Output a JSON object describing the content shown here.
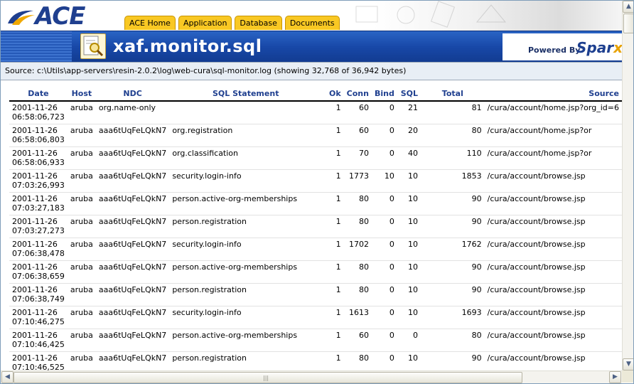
{
  "header": {
    "logo_text": "ACE",
    "tabs": [
      "ACE Home",
      "Application",
      "Database",
      "Documents"
    ],
    "page_title": "xaf.monitor.sql",
    "powered_by": "Powered By",
    "brand": "Spar",
    "brand_x": "x"
  },
  "source_line": "Source: c:\\Utils\\app-servers\\resin-2.0.2\\log\\web-cura\\sql-monitor.log (showing 32,768 of 36,942 bytes)",
  "table": {
    "columns": [
      "Date",
      "Host",
      "NDC",
      "SQL Statement",
      "Ok",
      "Conn",
      "Bind",
      "SQL",
      "Total",
      "Source"
    ],
    "rows": [
      {
        "date": "2001-11-26 06:58:06,723",
        "host": "aruba",
        "ndc": "org.name-only",
        "sql": "",
        "ok": "1",
        "conn": "60",
        "bind": "0",
        "sqlt": "21",
        "total": "81",
        "source": "/cura/account/home.jsp?org_id=6"
      },
      {
        "date": "2001-11-26 06:58:06,803",
        "host": "aruba",
        "ndc": "aaa6tUqFeLQkN7",
        "sql": "org.registration",
        "ok": "1",
        "conn": "60",
        "bind": "0",
        "sqlt": "20",
        "total": "80",
        "source": "/cura/account/home.jsp?or"
      },
      {
        "date": "2001-11-26 06:58:06,933",
        "host": "aruba",
        "ndc": "aaa6tUqFeLQkN7",
        "sql": "org.classification",
        "ok": "1",
        "conn": "70",
        "bind": "0",
        "sqlt": "40",
        "total": "110",
        "source": "/cura/account/home.jsp?or"
      },
      {
        "date": "2001-11-26 07:03:26,993",
        "host": "aruba",
        "ndc": "aaa6tUqFeLQkN7",
        "sql": "security.login-info",
        "ok": "1",
        "conn": "1773",
        "bind": "10",
        "sqlt": "10",
        "total": "1853",
        "source": "/cura/account/browse.jsp"
      },
      {
        "date": "2001-11-26 07:03:27,183",
        "host": "aruba",
        "ndc": "aaa6tUqFeLQkN7",
        "sql": "person.active-org-memberships",
        "ok": "1",
        "conn": "80",
        "bind": "0",
        "sqlt": "10",
        "total": "90",
        "source": "/cura/account/browse.jsp"
      },
      {
        "date": "2001-11-26 07:03:27,273",
        "host": "aruba",
        "ndc": "aaa6tUqFeLQkN7",
        "sql": "person.registration",
        "ok": "1",
        "conn": "80",
        "bind": "0",
        "sqlt": "10",
        "total": "90",
        "source": "/cura/account/browse.jsp"
      },
      {
        "date": "2001-11-26 07:06:38,478",
        "host": "aruba",
        "ndc": "aaa6tUqFeLQkN7",
        "sql": "security.login-info",
        "ok": "1",
        "conn": "1702",
        "bind": "0",
        "sqlt": "10",
        "total": "1762",
        "source": "/cura/account/browse.jsp"
      },
      {
        "date": "2001-11-26 07:06:38,659",
        "host": "aruba",
        "ndc": "aaa6tUqFeLQkN7",
        "sql": "person.active-org-memberships",
        "ok": "1",
        "conn": "80",
        "bind": "0",
        "sqlt": "10",
        "total": "90",
        "source": "/cura/account/browse.jsp"
      },
      {
        "date": "2001-11-26 07:06:38,749",
        "host": "aruba",
        "ndc": "aaa6tUqFeLQkN7",
        "sql": "person.registration",
        "ok": "1",
        "conn": "80",
        "bind": "0",
        "sqlt": "10",
        "total": "90",
        "source": "/cura/account/browse.jsp"
      },
      {
        "date": "2001-11-26 07:10:46,275",
        "host": "aruba",
        "ndc": "aaa6tUqFeLQkN7",
        "sql": "security.login-info",
        "ok": "1",
        "conn": "1613",
        "bind": "0",
        "sqlt": "10",
        "total": "1693",
        "source": "/cura/account/browse.jsp"
      },
      {
        "date": "2001-11-26 07:10:46,425",
        "host": "aruba",
        "ndc": "aaa6tUqFeLQkN7",
        "sql": "person.active-org-memberships",
        "ok": "1",
        "conn": "60",
        "bind": "0",
        "sqlt": "0",
        "total": "80",
        "source": "/cura/account/browse.jsp"
      },
      {
        "date": "2001-11-26 07:10:46,525",
        "host": "aruba",
        "ndc": "aaa6tUqFeLQkN7",
        "sql": "person.registration",
        "ok": "1",
        "conn": "80",
        "bind": "0",
        "sqlt": "10",
        "total": "90",
        "source": "/cura/account/browse.jsp"
      }
    ]
  },
  "scrollbars": {
    "up_arrow": "▲",
    "down_arrow": "▼",
    "left_arrow": "◀",
    "right_arrow": "▶",
    "grip": "|||"
  }
}
